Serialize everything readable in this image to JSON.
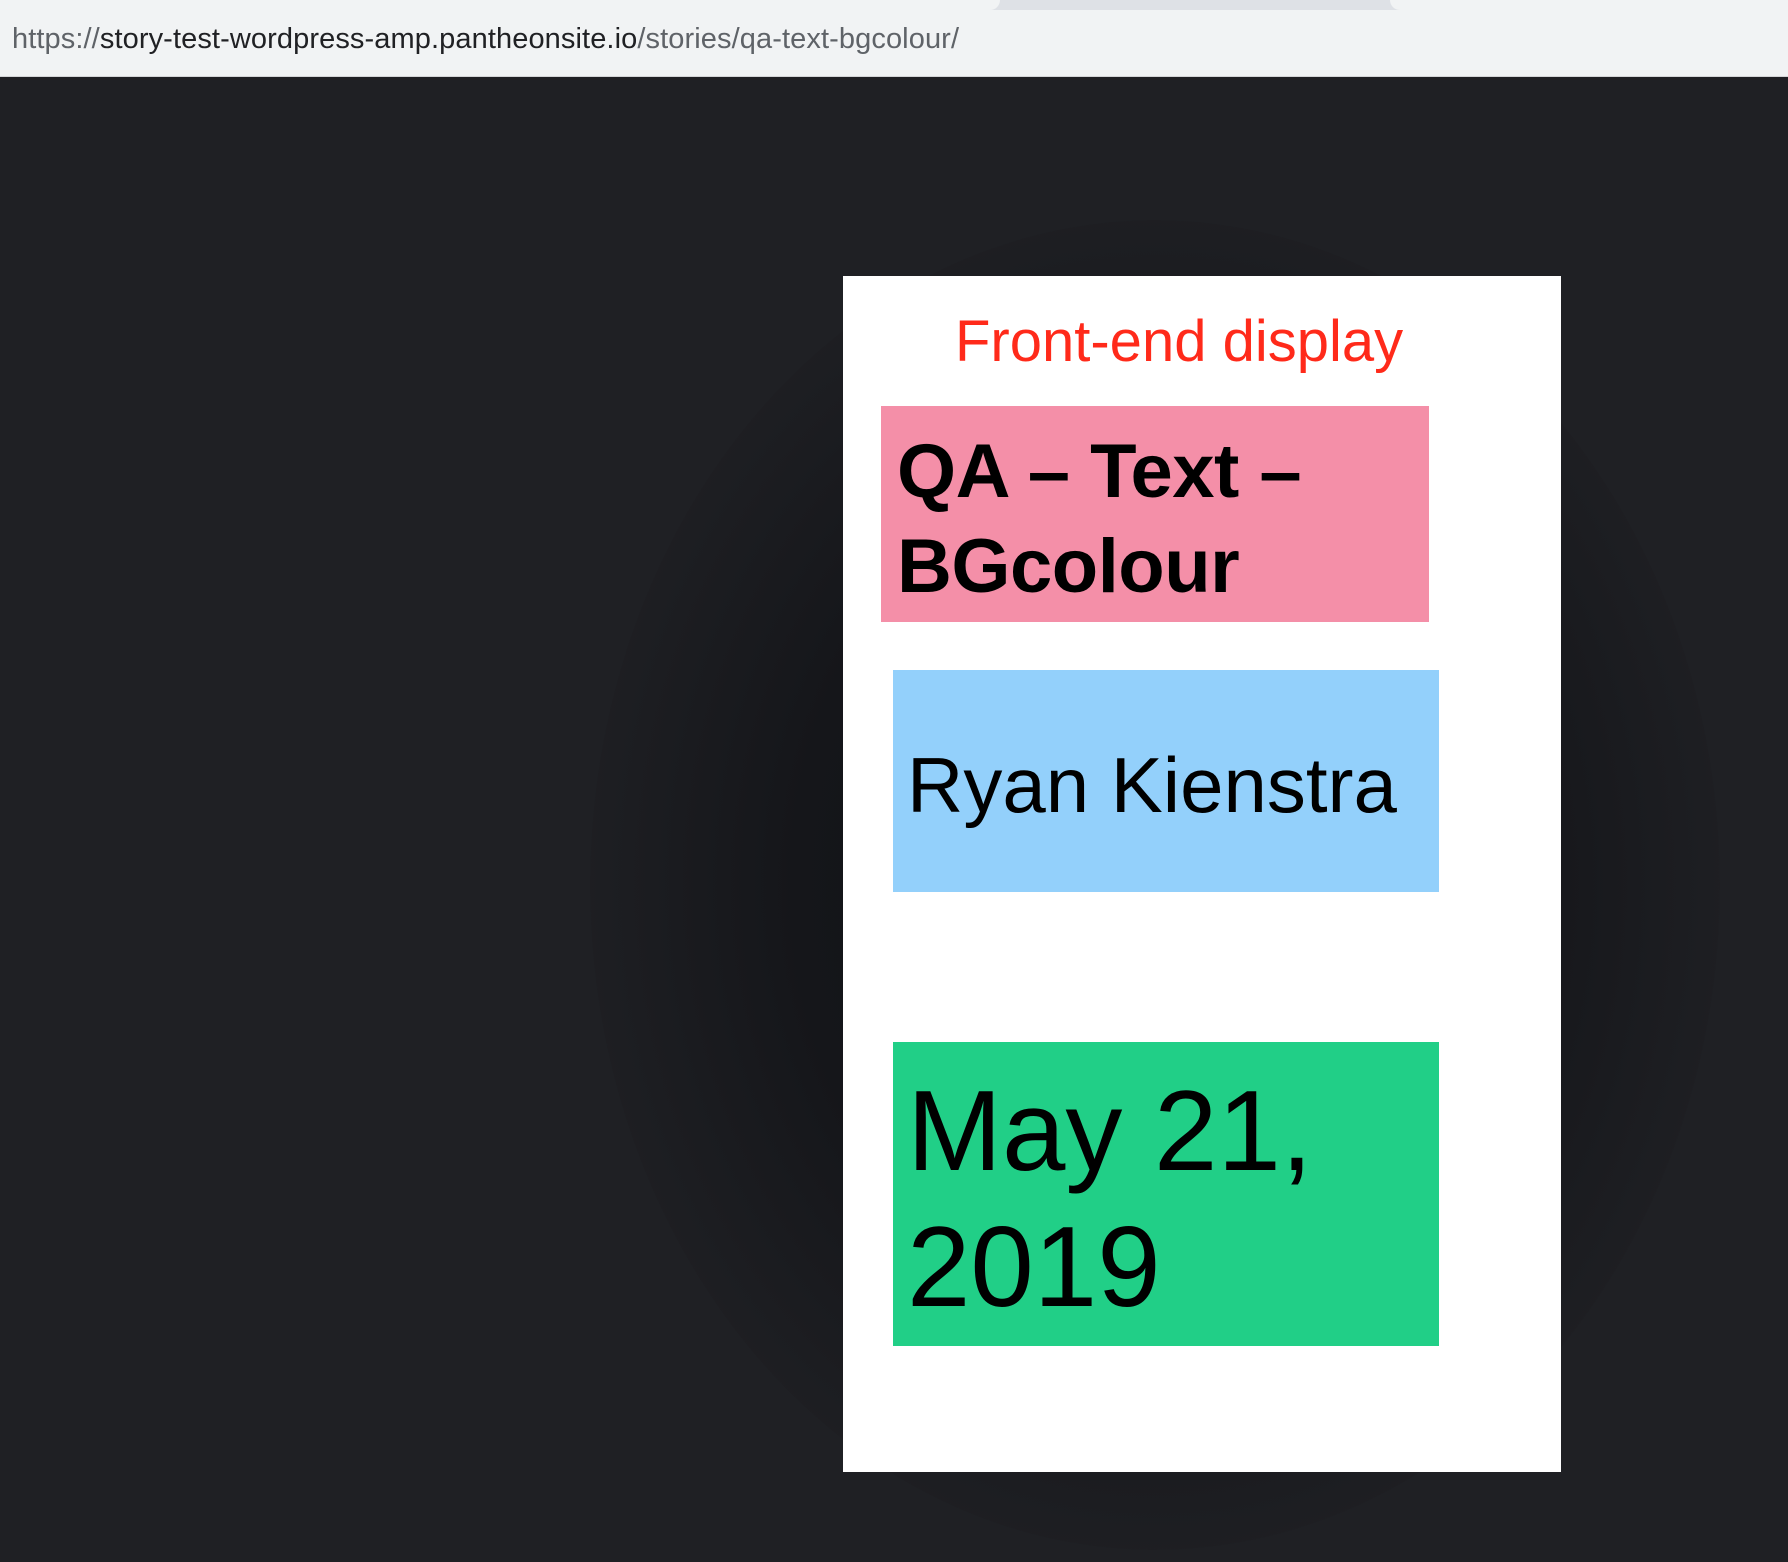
{
  "browser": {
    "url_scheme": "https://",
    "url_host": "story-test-wordpress-amp.pantheonsite.io",
    "url_path": "/stories/qa-text-bgcolour/"
  },
  "story": {
    "annotation": "Front-end display",
    "title": "QA – Text – BGcolour",
    "author": "Ryan Kienstra",
    "date": "May 21, 2019"
  },
  "colors": {
    "page_background": "#1f2024",
    "annotation": "#ff2a1a",
    "title_background": "#f48fa8",
    "author_background": "#93d0fb",
    "date_background": "#21cf87"
  }
}
